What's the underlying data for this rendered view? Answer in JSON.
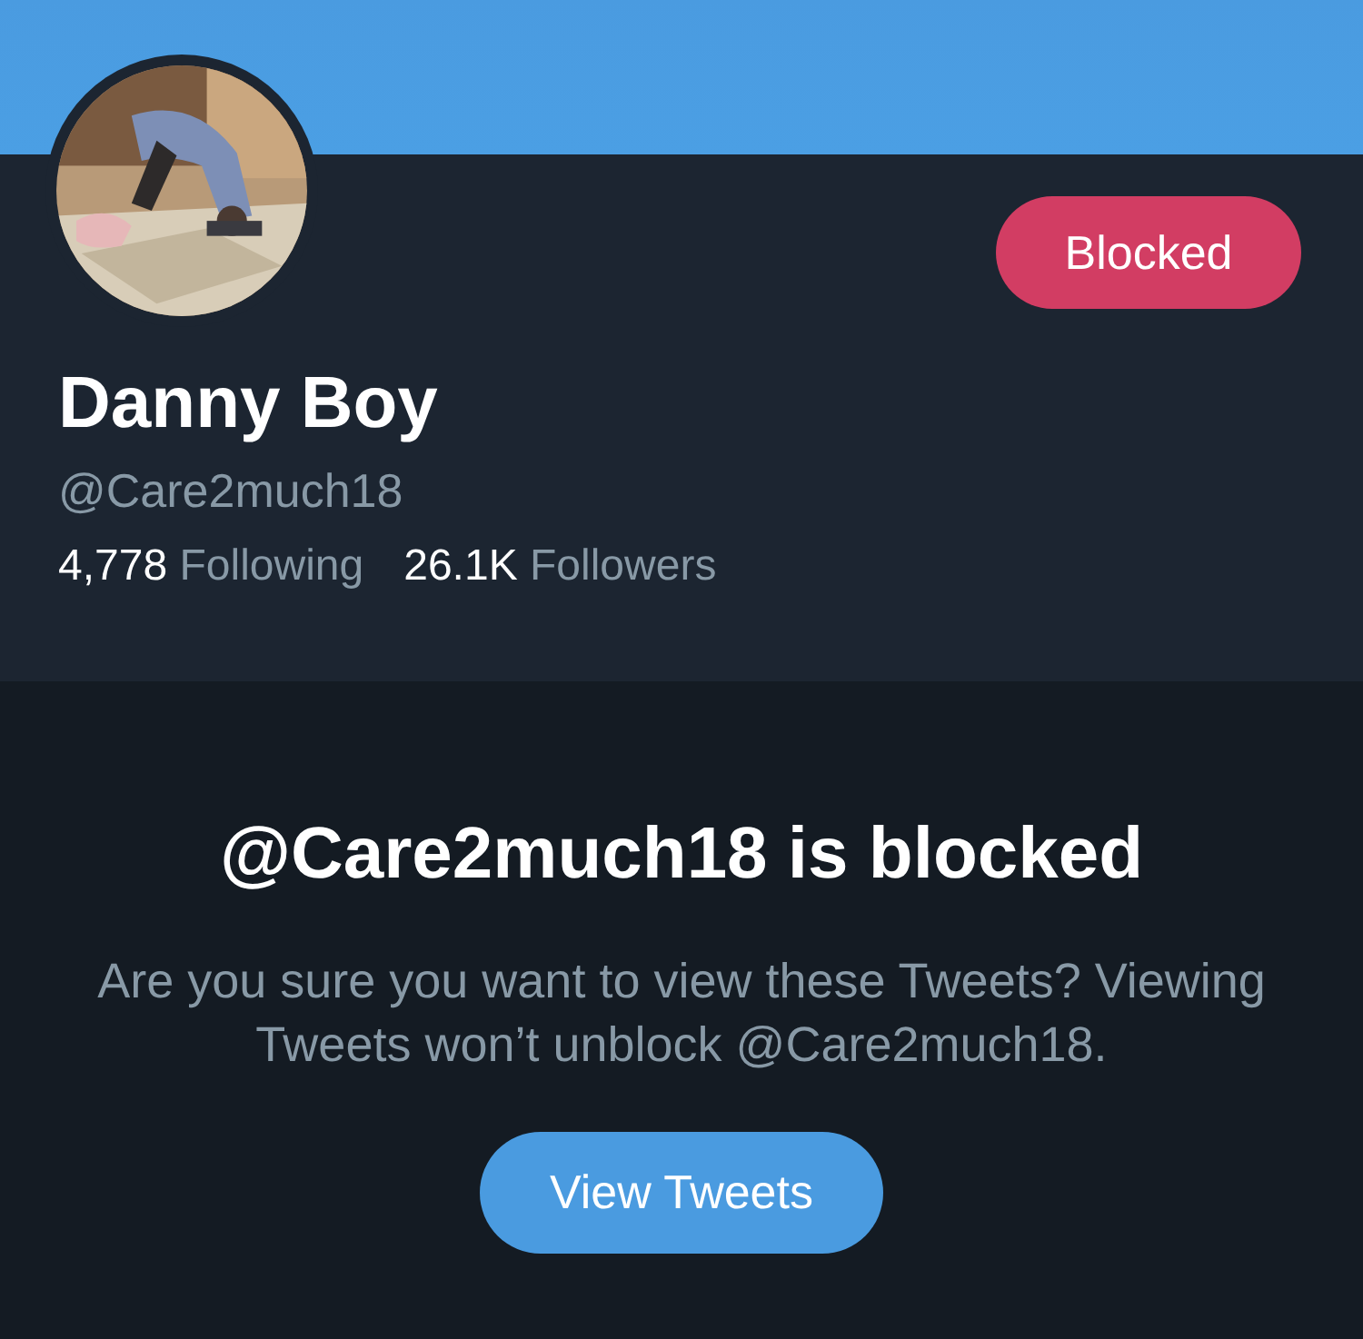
{
  "profile": {
    "name": "Danny Boy",
    "handle": "@Care2much18",
    "blocked_button": "Blocked",
    "stats": [
      {
        "count": "4,778",
        "label": "Following"
      },
      {
        "count": "26.1K",
        "label": "Followers"
      }
    ]
  },
  "notice": {
    "title": "@Care2much18 is blocked",
    "message": "Are you sure you want to view these Tweets? Viewing Tweets won’t unblock @Care2much18.",
    "button": "View Tweets"
  }
}
